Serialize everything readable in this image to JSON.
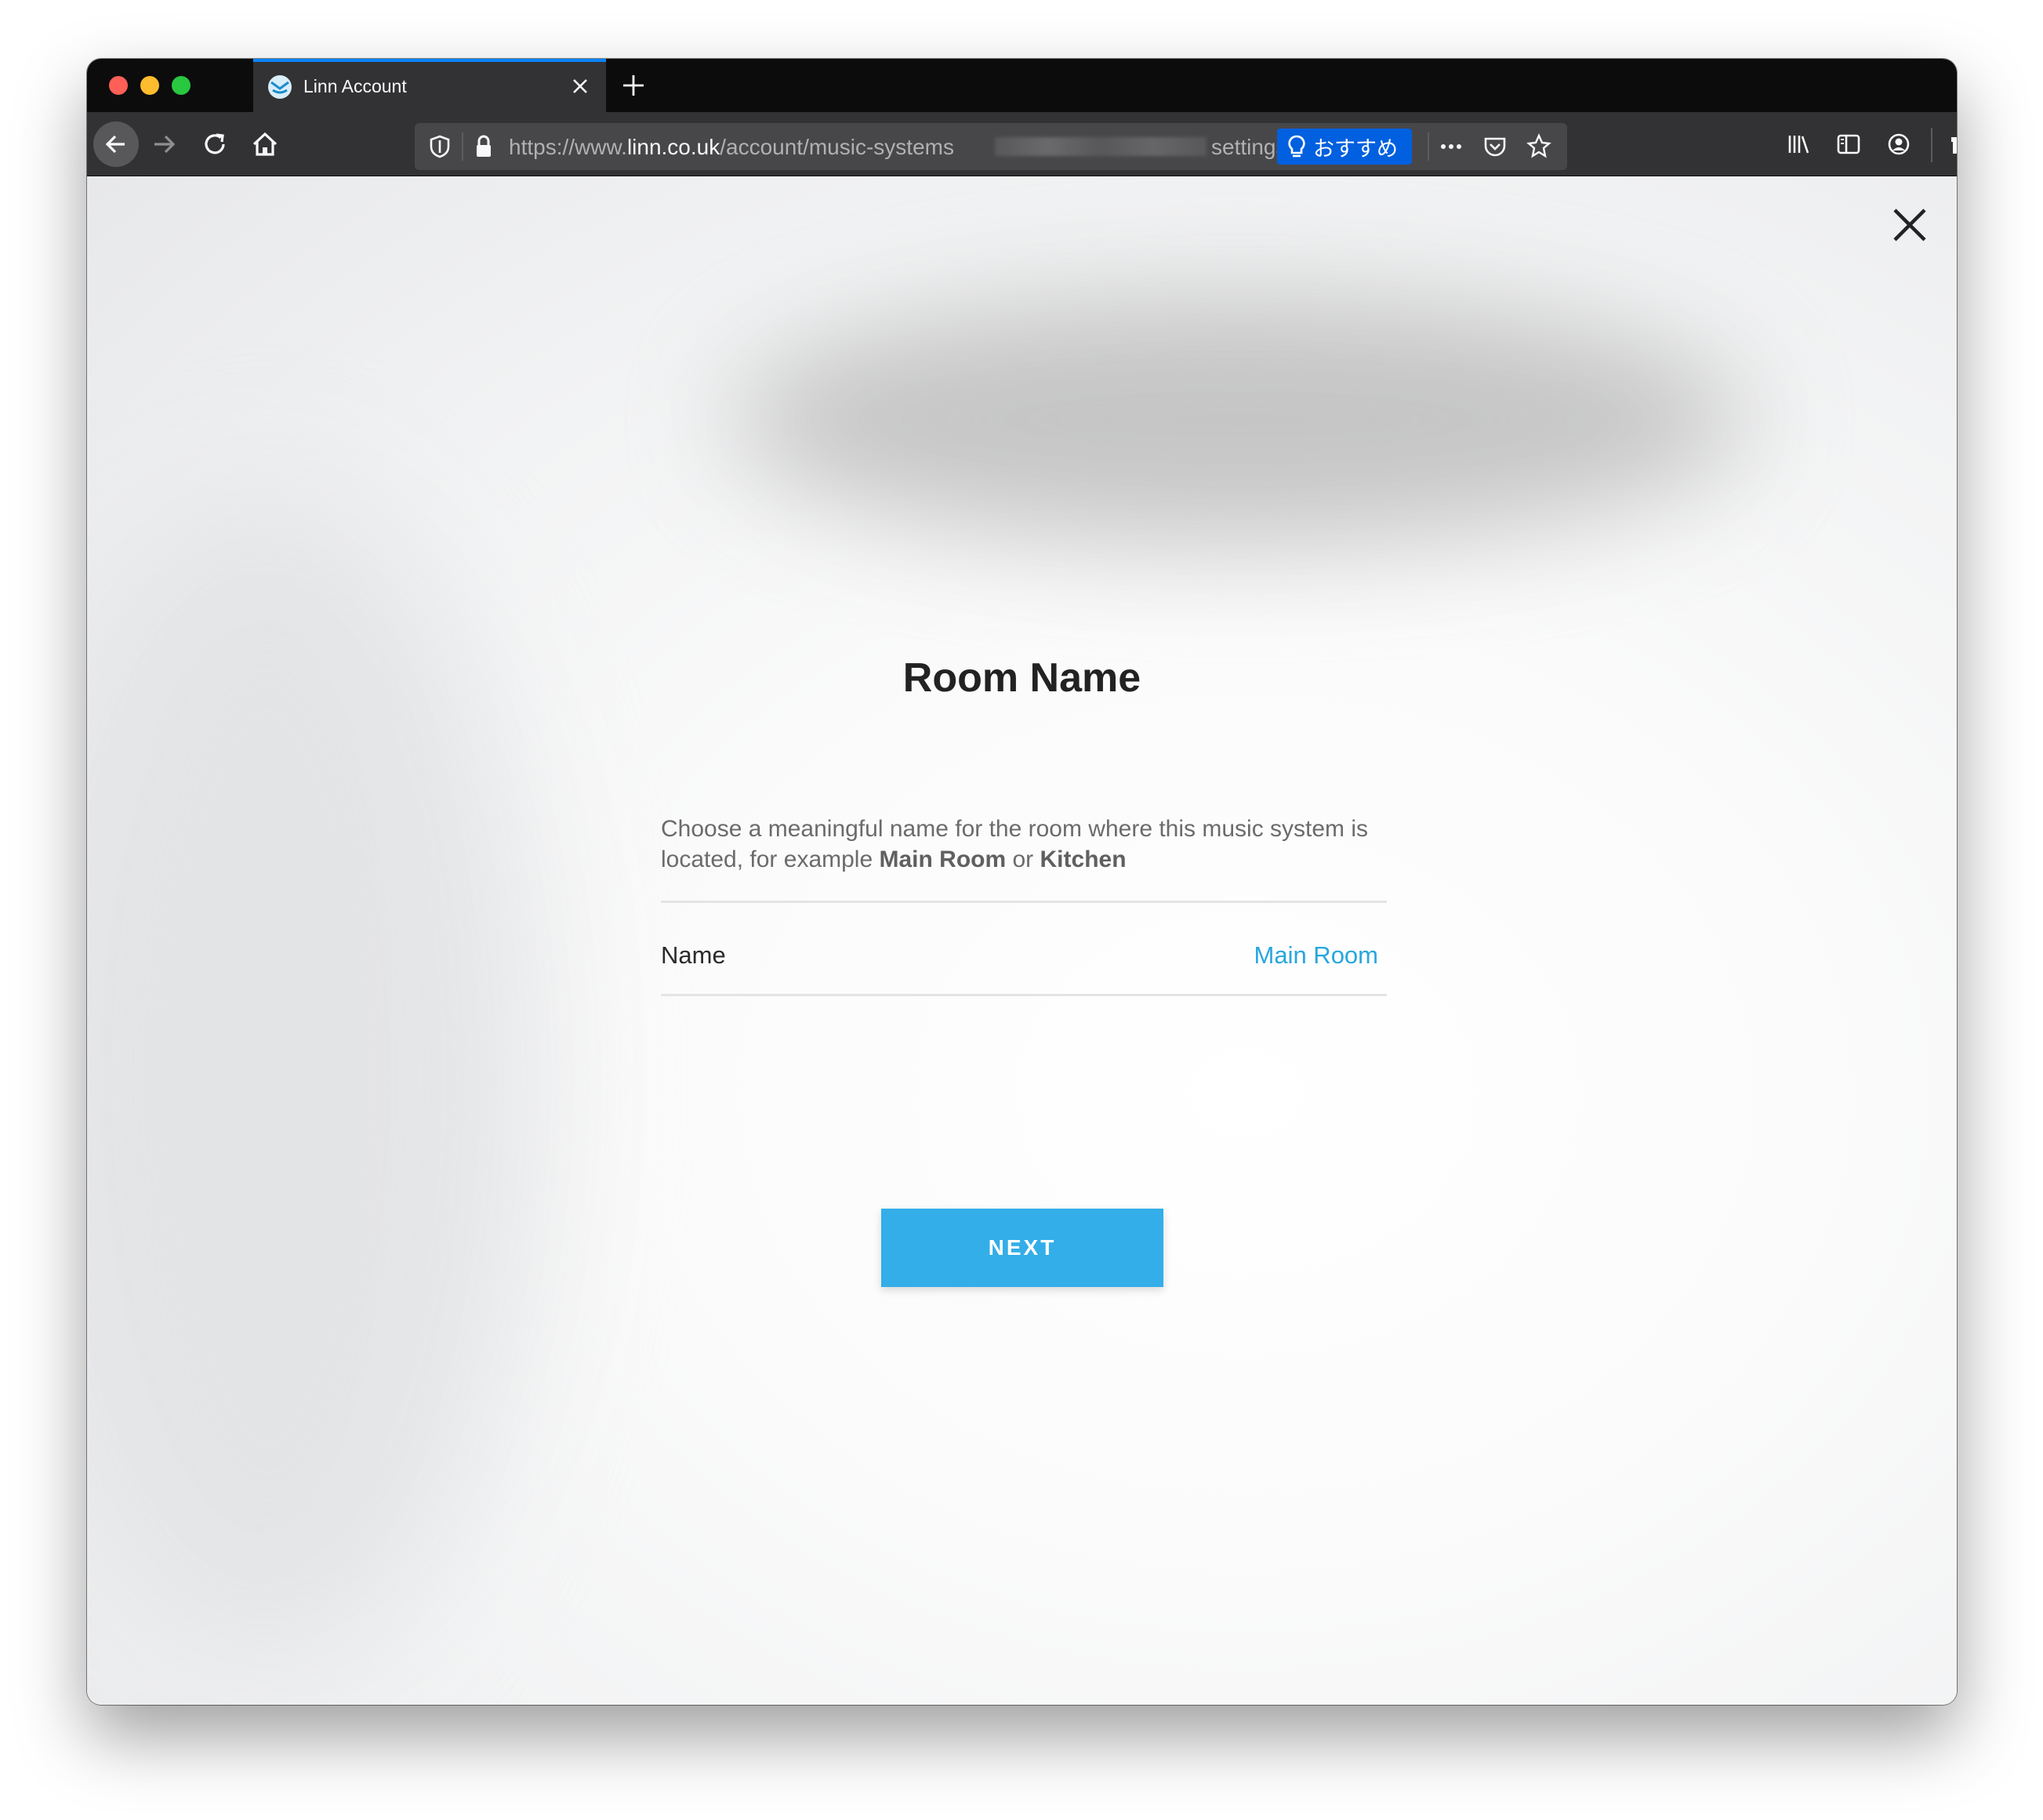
{
  "browser": {
    "tab_title": "Linn Account",
    "url_scheme": "https://www.",
    "url_host": "linn.co.uk",
    "url_path": "/account/music-systems",
    "url_tail": "settings",
    "recommend_label": "おすすめ"
  },
  "dialog": {
    "title": "Room Name",
    "description_prefix": "Choose a meaningful name for the room where this music system is located, for example ",
    "example_one": "Main Room",
    "conjunction": " or ",
    "example_two": "Kitchen",
    "field_label": "Name",
    "field_value": "Main Room",
    "next_label": "NEXT"
  },
  "colors": {
    "accent": "#33aee8",
    "link": "#27a6e0",
    "firefox_blue": "#0060df"
  }
}
